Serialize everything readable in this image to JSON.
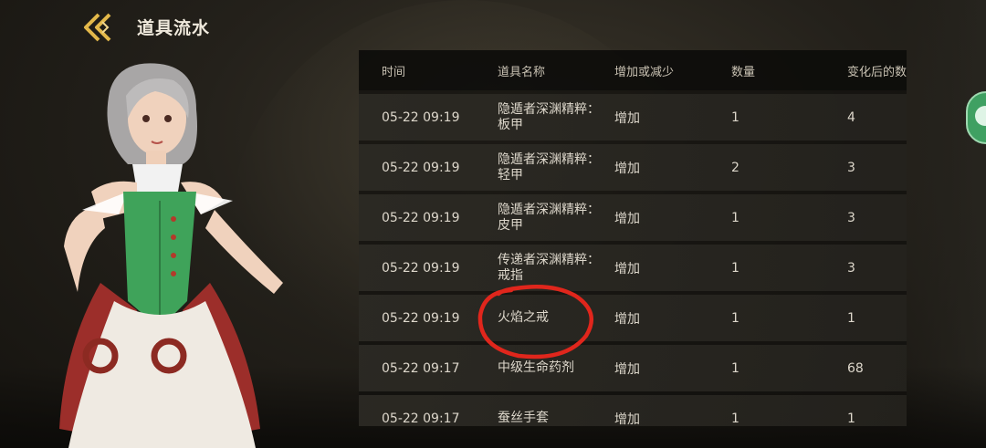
{
  "header": {
    "title": "道具流水",
    "back_icon": "chevron-left-icon",
    "accent": "#e3b84a"
  },
  "table": {
    "columns": [
      "时间",
      "道具名称",
      "增加或减少",
      "数量",
      "变化后的数"
    ],
    "rows": [
      {
        "time": "05-22 09:19",
        "name": "隐遁者深渊精粹：板甲",
        "change": "增加",
        "qty": "1",
        "after": "4"
      },
      {
        "time": "05-22 09:19",
        "name": "隐遁者深渊精粹：轻甲",
        "change": "增加",
        "qty": "2",
        "after": "3"
      },
      {
        "time": "05-22 09:19",
        "name": "隐遁者深渊精粹：皮甲",
        "change": "增加",
        "qty": "1",
        "after": "3"
      },
      {
        "time": "05-22 09:19",
        "name": "传递者深渊精粹：戒指",
        "change": "增加",
        "qty": "1",
        "after": "3"
      },
      {
        "time": "05-22 09:19",
        "name": "火焰之戒",
        "change": "增加",
        "qty": "1",
        "after": "1"
      },
      {
        "time": "05-22 09:17",
        "name": "中级生命药剂",
        "change": "增加",
        "qty": "1",
        "after": "68"
      },
      {
        "time": "05-22 09:17",
        "name": "蚕丝手套",
        "change": "增加",
        "qty": "1",
        "after": "1"
      }
    ]
  },
  "annotation": {
    "color": "#e0261c",
    "icon": "red-circle-annotation"
  },
  "side_button": {
    "icon": "chat-icon",
    "color": "#3fa062"
  }
}
